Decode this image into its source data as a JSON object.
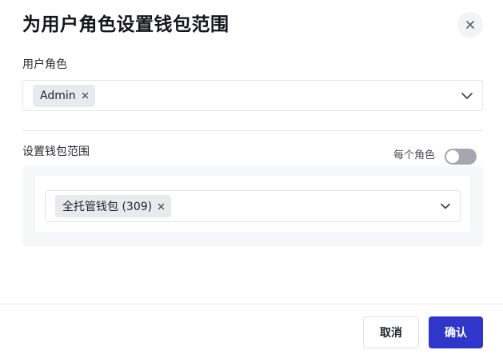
{
  "dialog": {
    "title": "为用户角色设置钱包范围"
  },
  "role_field": {
    "label": "用户角色",
    "selected_tags": [
      "Admin"
    ]
  },
  "scope_field": {
    "label": "设置钱包范围",
    "per_role_label": "每个角色",
    "per_role_enabled": false,
    "selected_tags": [
      "全托管钱包 (309)"
    ]
  },
  "footer": {
    "cancel_label": "取消",
    "confirm_label": "确认"
  },
  "colors": {
    "primary": "#2f36c9",
    "toggle_off": "#a4a7b0",
    "tag_bg": "#e9eaee"
  },
  "icons": {
    "close": "close-icon",
    "tag_remove": "close-icon",
    "dropdown": "chevron-down-icon"
  }
}
